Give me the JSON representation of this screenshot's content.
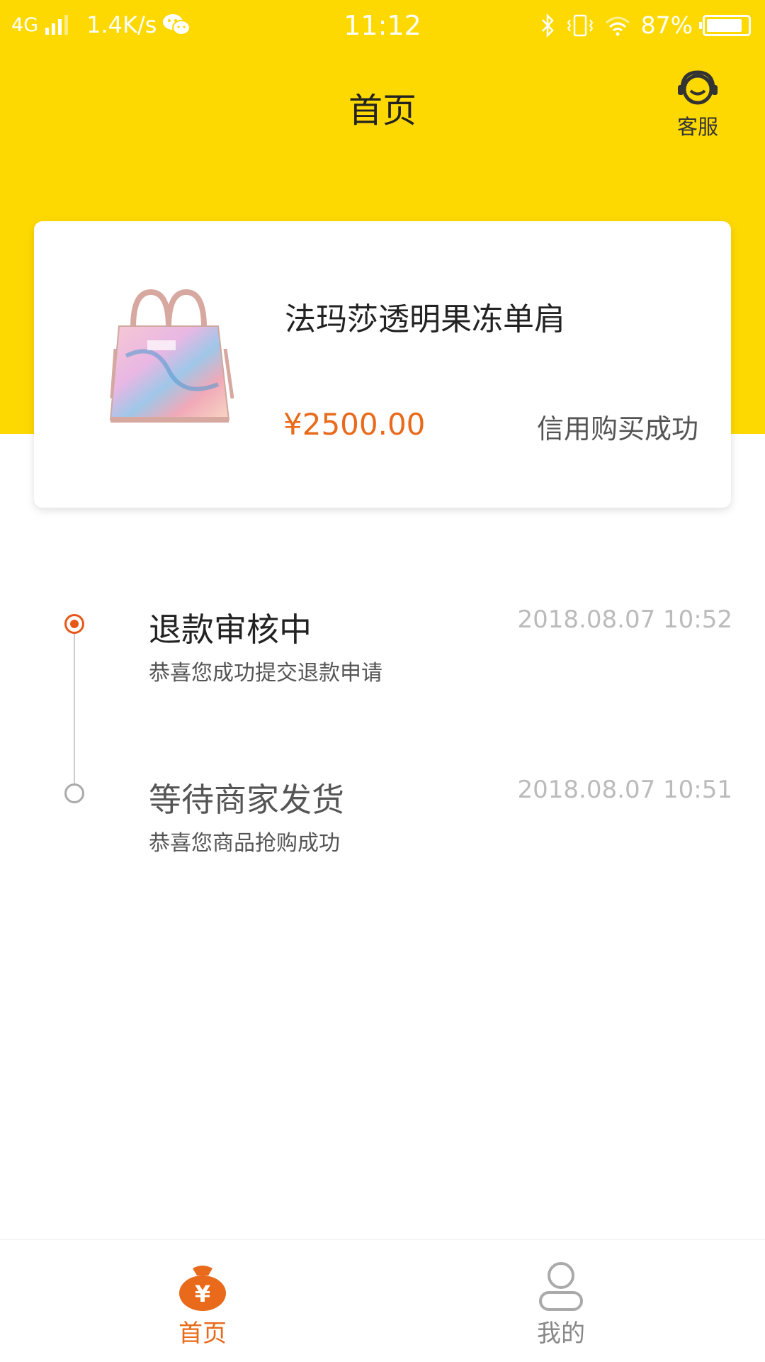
{
  "colors": {
    "header_bg": "#FED901",
    "accent_orange": "#E86A1A",
    "timeline_active": "#E8571A",
    "text_dark": "#222222",
    "text_muted": "#bbbbbb"
  },
  "status_bar": {
    "network": "4G",
    "speed": "1.4K/s",
    "time": "11:12",
    "battery": "87%",
    "battery_level": 0.87,
    "icons": [
      "signal-icon",
      "wechat-icon",
      "bluetooth-icon",
      "vibrate-icon",
      "wifi-icon",
      "battery-icon"
    ]
  },
  "header": {
    "title": "首页",
    "support_label": "客服",
    "support_icon": "headset-icon"
  },
  "product": {
    "name": "法玛莎透明果冻单肩",
    "price": "¥2500.00",
    "status": "信用购买成功",
    "image": "handbag-image"
  },
  "timeline": [
    {
      "title": "退款审核中",
      "desc": "恭喜您成功提交退款申请",
      "time": "2018.08.07 10:52",
      "active": true
    },
    {
      "title": "等待商家发货",
      "desc": "恭喜您商品抢购成功",
      "time": "2018.08.07 10:51",
      "active": false
    }
  ],
  "bottom_nav": [
    {
      "label": "首页",
      "icon": "money-bag-icon",
      "active": true
    },
    {
      "label": "我的",
      "icon": "user-icon",
      "active": false
    }
  ]
}
